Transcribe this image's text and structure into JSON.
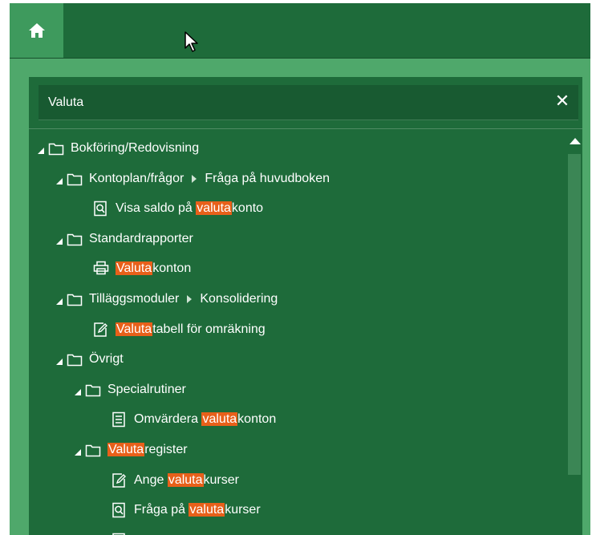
{
  "search": {
    "value": "Valuta",
    "clear_label": "✕"
  },
  "tree": {
    "rows": [
      {
        "depth": 0,
        "type": "folder",
        "parts": [
          {
            "text": "Bokföring/Redovisning",
            "hl": false
          }
        ]
      },
      {
        "depth": 1,
        "type": "folder",
        "parts": [
          {
            "text": "Kontoplan/frågor",
            "hl": false
          }
        ],
        "trail": "Fråga på huvudboken"
      },
      {
        "depth": 2,
        "type": "leaf",
        "icon": "search-doc-icon",
        "parts": [
          {
            "text": "Visa saldo på ",
            "hl": false
          },
          {
            "text": "valuta",
            "hl": true
          },
          {
            "text": "konto",
            "hl": false
          }
        ]
      },
      {
        "depth": 1,
        "type": "folder",
        "parts": [
          {
            "text": "Standardrapporter",
            "hl": false
          }
        ]
      },
      {
        "depth": 2,
        "type": "leaf",
        "icon": "printer-icon",
        "parts": [
          {
            "text": "Valuta",
            "hl": true
          },
          {
            "text": "konton",
            "hl": false
          }
        ]
      },
      {
        "depth": 1,
        "type": "folder",
        "parts": [
          {
            "text": "Tilläggsmoduler",
            "hl": false
          }
        ],
        "trail": "Konsolidering"
      },
      {
        "depth": 2,
        "type": "leaf",
        "icon": "edit-icon",
        "parts": [
          {
            "text": "Valuta",
            "hl": true
          },
          {
            "text": "tabell för omräkning",
            "hl": false
          }
        ]
      },
      {
        "depth": 1,
        "type": "folder",
        "parts": [
          {
            "text": "Övrigt",
            "hl": false
          }
        ]
      },
      {
        "depth": 2,
        "type": "folder",
        "parts": [
          {
            "text": "Specialrutiner",
            "hl": false
          }
        ]
      },
      {
        "depth": 3,
        "type": "leaf",
        "icon": "list-doc-icon",
        "parts": [
          {
            "text": "Omvärdera ",
            "hl": false
          },
          {
            "text": "valuta",
            "hl": true
          },
          {
            "text": "konton",
            "hl": false
          }
        ]
      },
      {
        "depth": 2,
        "type": "folder",
        "parts": [
          {
            "text": "Valuta",
            "hl": true
          },
          {
            "text": "register",
            "hl": false
          }
        ]
      },
      {
        "depth": 3,
        "type": "leaf",
        "icon": "edit-icon",
        "parts": [
          {
            "text": "Ange ",
            "hl": false
          },
          {
            "text": "valuta",
            "hl": true
          },
          {
            "text": "kurser",
            "hl": false
          }
        ]
      },
      {
        "depth": 3,
        "type": "leaf",
        "icon": "search-doc-icon",
        "parts": [
          {
            "text": "Fråga på ",
            "hl": false
          },
          {
            "text": "valuta",
            "hl": true
          },
          {
            "text": "kurser",
            "hl": false
          }
        ]
      },
      {
        "depth": 3,
        "type": "leaf",
        "icon": "list-doc-icon",
        "parts": []
      }
    ]
  },
  "colors": {
    "topbar": "#1e6b3a",
    "home": "#3e9a5d",
    "panel": "#1e6b3a",
    "highlight": "#e8601a"
  }
}
